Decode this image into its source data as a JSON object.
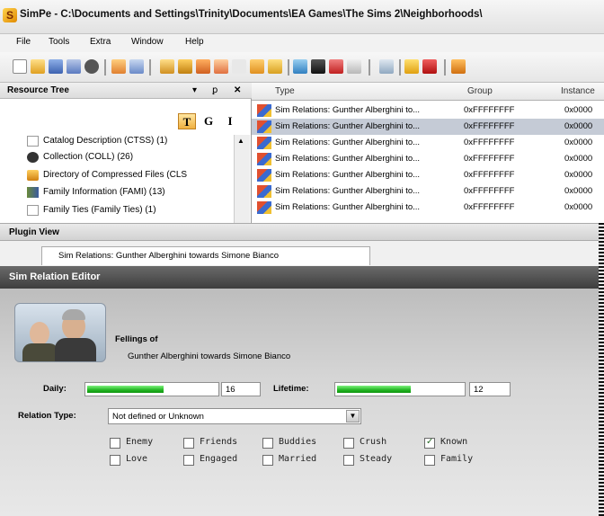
{
  "window": {
    "title": "SimPe - C:\\Documents and Settings\\Trinity\\Documents\\EA Games\\The Sims 2\\Neighborhoods\\"
  },
  "menu": [
    "File",
    "Tools",
    "Extra",
    "Window",
    "Help"
  ],
  "resource_tree": {
    "title": "Resource Tree",
    "header_controls": [
      "▾",
      "ꝑ",
      "✕"
    ],
    "mode_buttons": [
      "T",
      "G",
      "I"
    ],
    "items": [
      {
        "label": "Catalog Description (CTSS) (1)",
        "icon": "catalog-icon"
      },
      {
        "label": "Collection (COLL) (26)",
        "icon": "collection-icon"
      },
      {
        "label": "Directory of Compressed Files (CLS",
        "icon": "directory-icon"
      },
      {
        "label": "Family Information (FAMI) (13)",
        "icon": "family-icon"
      },
      {
        "label": "Family Ties (Family Ties) (1)",
        "icon": "ties-icon"
      }
    ]
  },
  "resource_list": {
    "columns": [
      "Type",
      "Group",
      "Instance"
    ],
    "rows": [
      {
        "type": "Sim Relations: Gunther Alberghini to...",
        "group": "0xFFFFFFFF",
        "instance": "0x0000",
        "selected": false
      },
      {
        "type": "Sim Relations: Gunther Alberghini to...",
        "group": "0xFFFFFFFF",
        "instance": "0x0000",
        "selected": true
      },
      {
        "type": "Sim Relations: Gunther Alberghini to...",
        "group": "0xFFFFFFFF",
        "instance": "0x0000",
        "selected": false
      },
      {
        "type": "Sim Relations: Gunther Alberghini to...",
        "group": "0xFFFFFFFF",
        "instance": "0x0000",
        "selected": false
      },
      {
        "type": "Sim Relations: Gunther Alberghini to...",
        "group": "0xFFFFFFFF",
        "instance": "0x0000",
        "selected": false
      },
      {
        "type": "Sim Relations: Gunther Alberghini to...",
        "group": "0xFFFFFFFF",
        "instance": "0x0000",
        "selected": false
      },
      {
        "type": "Sim Relations: Gunther Alberghini to...",
        "group": "0xFFFFFFFF",
        "instance": "0x0000",
        "selected": false
      }
    ]
  },
  "plugin_view": {
    "title": "Plugin View",
    "tab_label": "Sim Relations: Gunther Alberghini towards Simone Bianco"
  },
  "editor": {
    "title": "Sim Relation Editor",
    "feelings_heading": "Fellings of",
    "feelings_subject": "Gunther Alberghini towards Simone Bianco",
    "daily_label": "Daily:",
    "daily_value": "16",
    "daily_level": 0.58,
    "lifetime_label": "Lifetime:",
    "lifetime_value": "12",
    "lifetime_level": 0.58,
    "relation_type_label": "Relation Type:",
    "relation_type_value": "Not defined or Unknown",
    "flags": [
      {
        "label": "Enemy",
        "checked": false
      },
      {
        "label": "Friends",
        "checked": false
      },
      {
        "label": "Buddies",
        "checked": false
      },
      {
        "label": "Crush",
        "checked": false
      },
      {
        "label": "Known",
        "checked": true
      },
      {
        "label": "Love",
        "checked": false
      },
      {
        "label": "Engaged",
        "checked": false
      },
      {
        "label": "Married",
        "checked": false
      },
      {
        "label": "Steady",
        "checked": false
      },
      {
        "label": "Family",
        "checked": false
      }
    ]
  },
  "colors": {
    "selection": "#c5cbd6",
    "editor_header": "#4a4a4a",
    "bar_fill": "#22b522"
  }
}
